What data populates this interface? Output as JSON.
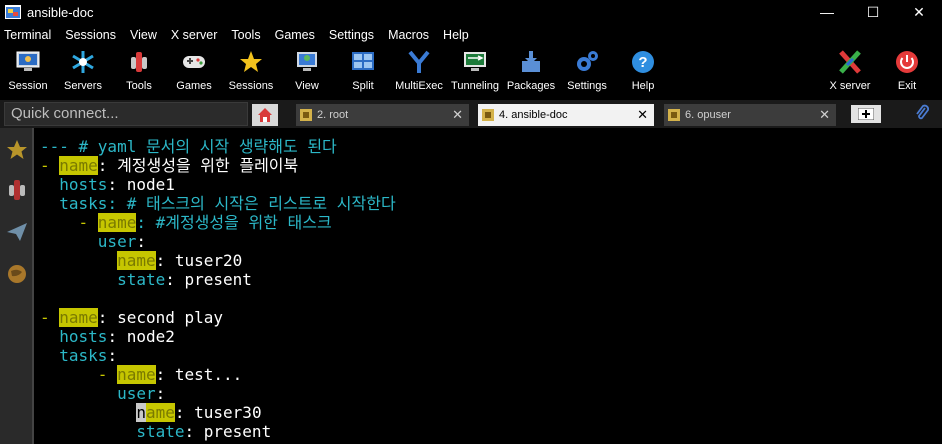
{
  "window": {
    "title": "ansible-doc",
    "controls": [
      "—",
      "☐",
      "✕"
    ]
  },
  "menu": [
    "Terminal",
    "Sessions",
    "View",
    "X server",
    "Tools",
    "Games",
    "Settings",
    "Macros",
    "Help"
  ],
  "toolbar": {
    "session": "Session",
    "servers": "Servers",
    "tools": "Tools",
    "games": "Games",
    "sessions": "Sessions",
    "view": "View",
    "split": "Split",
    "multiexec": "MultiExec",
    "tunneling": "Tunneling",
    "packages": "Packages",
    "settings": "Settings",
    "help": "Help",
    "xserver": "X server",
    "exit": "Exit"
  },
  "quick_connect": {
    "placeholder": "Quick connect..."
  },
  "tabs": [
    {
      "label": "2. root",
      "active": false
    },
    {
      "label": "4. ansible-doc",
      "active": true
    },
    {
      "label": "6. opuser",
      "active": false
    }
  ],
  "terminal": {
    "lines": [
      {
        "parts": [
          {
            "t": "--- # yaml 문서의 시작 생략해도 된다",
            "c": "cyan"
          }
        ]
      },
      {
        "parts": [
          {
            "t": "- ",
            "c": "yellow"
          },
          {
            "t": "name",
            "c": "hl"
          },
          {
            "t": ": 계정생성을 위한 플레이북",
            "c": "white"
          }
        ]
      },
      {
        "parts": [
          {
            "t": "  hosts",
            "c": "cyan"
          },
          {
            "t": ": node1",
            "c": "white"
          }
        ]
      },
      {
        "parts": [
          {
            "t": "  tasks",
            "c": "cyan"
          },
          {
            "t": ": # 태스크의 시작은 리스트로 시작한다",
            "c": "cyan"
          }
        ]
      },
      {
        "parts": [
          {
            "t": "    - ",
            "c": "yellow"
          },
          {
            "t": "name",
            "c": "hl"
          },
          {
            "t": ": #계정생성을 위한 태스크",
            "c": "cyan"
          }
        ]
      },
      {
        "parts": [
          {
            "t": "      user",
            "c": "cyan"
          },
          {
            "t": ":",
            "c": "white"
          }
        ]
      },
      {
        "parts": [
          {
            "t": "        ",
            "c": "white"
          },
          {
            "t": "name",
            "c": "hl"
          },
          {
            "t": ": tuser20",
            "c": "white"
          }
        ]
      },
      {
        "parts": [
          {
            "t": "        state",
            "c": "cyan"
          },
          {
            "t": ": present",
            "c": "white"
          }
        ]
      },
      {
        "parts": [
          {
            "t": "",
            "c": "white"
          }
        ]
      },
      {
        "parts": [
          {
            "t": "- ",
            "c": "yellow"
          },
          {
            "t": "name",
            "c": "hl"
          },
          {
            "t": ": second play",
            "c": "white"
          }
        ]
      },
      {
        "parts": [
          {
            "t": "  hosts",
            "c": "cyan"
          },
          {
            "t": ": node2",
            "c": "white"
          }
        ]
      },
      {
        "parts": [
          {
            "t": "  tasks",
            "c": "cyan"
          },
          {
            "t": ":",
            "c": "white"
          }
        ]
      },
      {
        "parts": [
          {
            "t": "      - ",
            "c": "yellow"
          },
          {
            "t": "name",
            "c": "hl"
          },
          {
            "t": ": test...",
            "c": "white"
          }
        ]
      },
      {
        "parts": [
          {
            "t": "        user",
            "c": "cyan"
          },
          {
            "t": ":",
            "c": "white"
          }
        ]
      },
      {
        "parts": [
          {
            "t": "          ",
            "c": "white"
          },
          {
            "t": "n",
            "c": "cursor"
          },
          {
            "t": "ame",
            "c": "hl"
          },
          {
            "t": ": tuser30",
            "c": "white"
          }
        ]
      },
      {
        "parts": [
          {
            "t": "          state",
            "c": "cyan"
          },
          {
            "t": ": present",
            "c": "white"
          }
        ]
      }
    ]
  },
  "colors": {
    "cyan": "#2cb8c8",
    "yellow": "#c8c800",
    "highlight_bg": "#c6c600",
    "background": "#000000"
  }
}
